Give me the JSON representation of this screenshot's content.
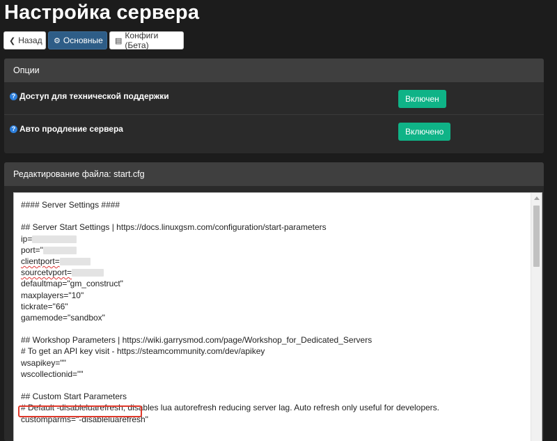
{
  "header": {
    "title": "Настройка сервера"
  },
  "nav": {
    "back_label": "Назад",
    "main_label": "Основные",
    "configs_label": "Конфиги (Бета)"
  },
  "options_panel": {
    "title": "Опции",
    "rows": [
      {
        "label": "Доступ для технической поддержки",
        "status": "Включен"
      },
      {
        "label": "Авто продление сервера",
        "status": "Включено"
      }
    ]
  },
  "editor_panel": {
    "title": "Редактирование файла: start.cfg",
    "lines": [
      "#### Server Settings ####",
      "",
      "## Server Start Settings | https://docs.linuxgsm.com/configuration/start-parameters",
      "ip=",
      "port=\"",
      "clientport=",
      "sourcetvport=",
      "defaultmap=\"gm_construct\"",
      "maxplayers=\"10\"",
      "tickrate=\"66\"",
      "gamemode=\"sandbox\"",
      "",
      "## Workshop Parameters | https://wiki.garrysmod.com/page/Workshop_for_Dedicated_Servers",
      "# To get an API key visit - https://steamcommunity.com/dev/apikey",
      "wsapikey=\"\"",
      "wscollectionid=\"\"",
      "",
      "## Custom Start Parameters",
      "# Default -disableluarefresh, disables lua autorefresh reducing server lag. Auto refresh only useful for developers.",
      "customparms=\"-disableluarefresh\""
    ]
  },
  "colors": {
    "background": "#1c1c1c",
    "panel_header": "#3f3f3f",
    "accent_blue": "#2e5d87",
    "toggle_green": "#0fb387",
    "highlight_red": "#e0392b"
  }
}
